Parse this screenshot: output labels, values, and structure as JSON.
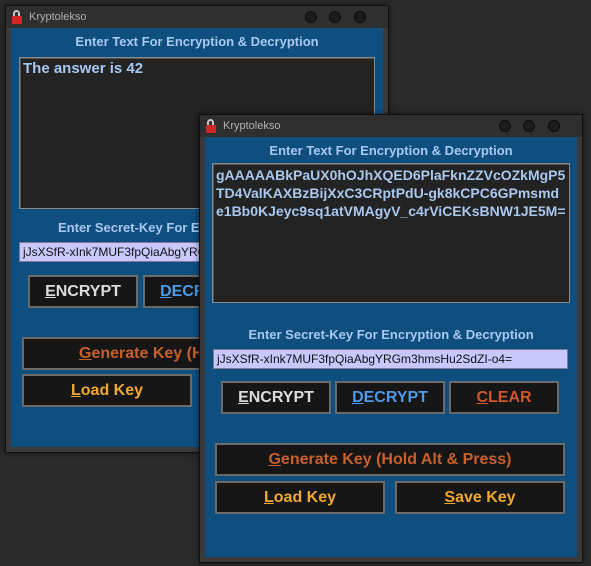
{
  "back_window": {
    "title": "Kryptolekso",
    "text_label": "Enter Text For Encryption & Decryption",
    "text_value": "The answer is 42",
    "key_label": "Enter Secret-Key For Encryption & Decryption",
    "key_value": "jJsXSfR-xInk7MUF3fpQiaAbgYRGm3hmsHu2SdZI-o4=",
    "encrypt_label": "ENCRYPT",
    "decrypt_label": "DECRYPT",
    "generate_label": "Generate Key (Hold Alt & Press)",
    "load_label": "Load Key"
  },
  "front_window": {
    "title": "Kryptolekso",
    "text_label": "Enter Text For Encryption & Decryption",
    "text_value": "gAAAAABkPaUX0hOJhXQED6PlaFknZZVcOZkMgP5TD4ValKAXBzBijXxC3CRptPdU-gk8kCPC6GPmsmde1Bb0KJeyc9sq1atVMAgyV_c4rViCEKsBNW1JE5M=",
    "key_label": "Enter Secret-Key For Encryption & Decryption",
    "key_value": "jJsXSfR-xInk7MUF3fpQiaAbgYRGm3hmsHu2SdZI-o4=",
    "encrypt_label": "ENCRYPT",
    "decrypt_label": "DECRYPT",
    "clear_label": "CLEAR",
    "generate_label": "Generate Key (Hold Alt & Press)",
    "load_label": "Load Key",
    "save_label": "Save Key"
  },
  "icons": {
    "app": "lock-icon"
  },
  "colors": {
    "client_bg": "#0f4f80",
    "label_text": "#a9c8f0",
    "key_field_bg": "#c8c8ff",
    "button_bg": "#161616",
    "decrypt_text": "#4f9ae6",
    "clear_text": "#d0562b",
    "load_save_text": "#f0a830"
  }
}
